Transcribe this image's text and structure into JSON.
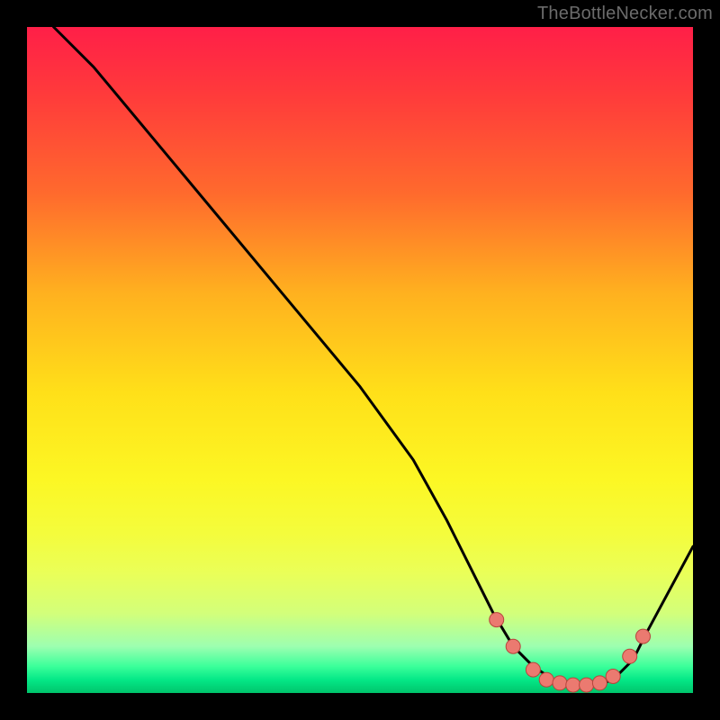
{
  "watermark": "TheBottleNecker.com",
  "colors": {
    "curve": "#000000",
    "marker_fill": "#eb7a70",
    "marker_stroke": "#b7453c"
  },
  "chart_data": {
    "type": "line",
    "title": "",
    "xlabel": "",
    "ylabel": "",
    "xlim": [
      0,
      100
    ],
    "ylim": [
      0,
      100
    ],
    "series": [
      {
        "name": "curve",
        "x": [
          4,
          10,
          20,
          30,
          40,
          50,
          58,
          63,
          67,
          70,
          73,
          76,
          79,
          82,
          85,
          88,
          91,
          93,
          100
        ],
        "y": [
          100,
          94,
          82,
          70,
          58,
          46,
          35,
          26,
          18,
          12,
          7,
          4,
          2,
          1,
          1,
          2,
          5,
          9,
          22
        ]
      }
    ],
    "markers": {
      "name": "highlight-points",
      "x": [
        70.5,
        73,
        76,
        78,
        80,
        82,
        84,
        86,
        88,
        90.5,
        92.5
      ],
      "y": [
        11,
        7,
        3.5,
        2,
        1.5,
        1.2,
        1.2,
        1.5,
        2.5,
        5.5,
        8.5
      ]
    }
  }
}
